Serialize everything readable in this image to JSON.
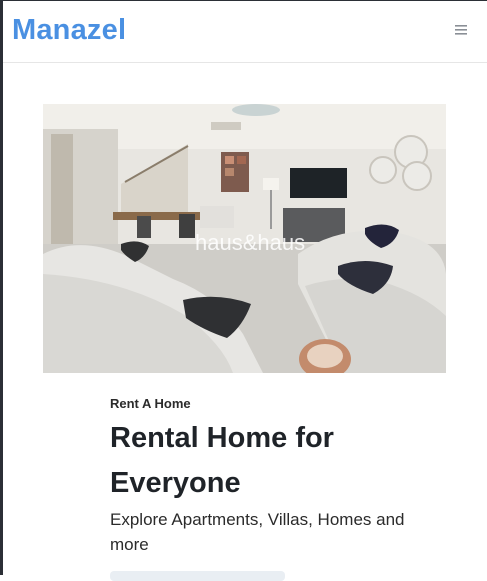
{
  "navbar": {
    "brand": "Manazel",
    "menu_icon": "hamburger-menu-icon"
  },
  "hero": {
    "image_watermark": "haus&haus",
    "eyebrow": "Rent A Home",
    "title": "Rental Home for Everyone",
    "subtitle": "Explore Apartments, Villas, Homes and more"
  },
  "colors": {
    "brand": "#4a90e2",
    "text": "#1f2328",
    "menu_icon": "#8a8f96"
  }
}
